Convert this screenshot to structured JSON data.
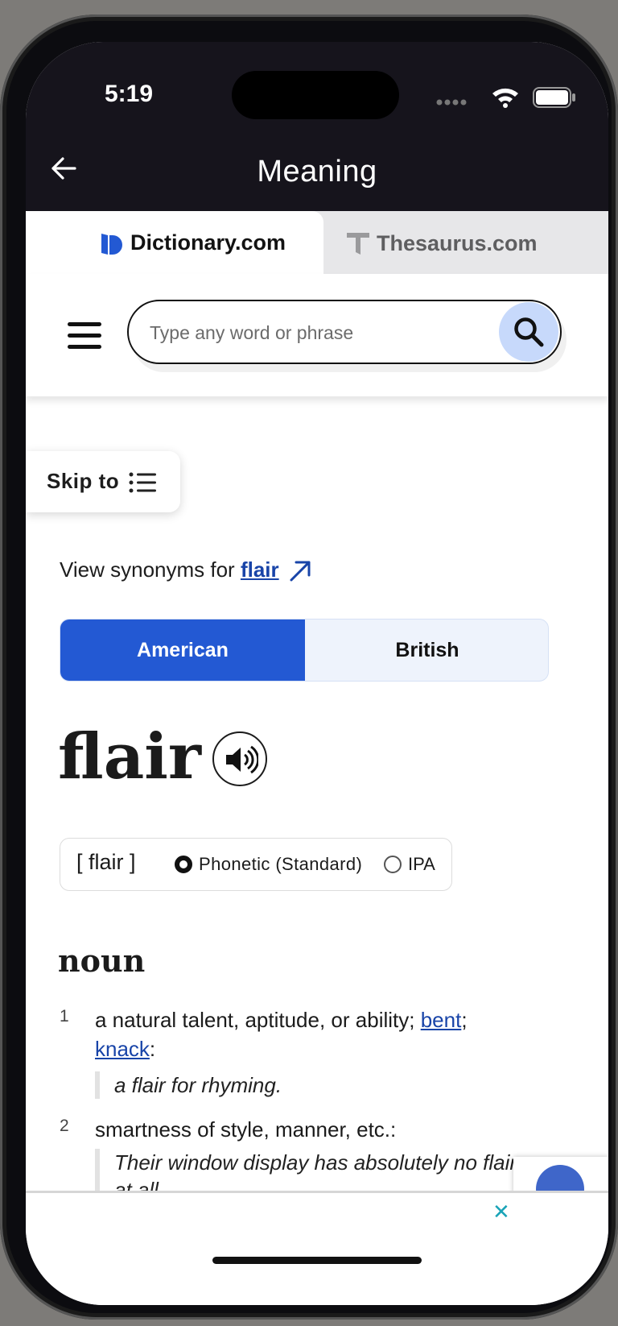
{
  "status_bar": {
    "time": "5:19"
  },
  "app_header": {
    "title": "Meaning",
    "back_icon": "arrow-left-icon"
  },
  "site_tabs": [
    {
      "label": "Dictionary.com",
      "active": true,
      "icon": "dictionary-logo-icon"
    },
    {
      "label": "Thesaurus.com",
      "active": false,
      "icon": "thesaurus-logo-icon"
    }
  ],
  "search": {
    "placeholder": "Type any word or phrase",
    "value": "",
    "icon": "search-icon",
    "button_color": "#c7d9fb"
  },
  "skip_to": {
    "label": "Skip to",
    "icon": "list-icon"
  },
  "synonyms": {
    "prefix": "View synonyms for ",
    "word": "flair"
  },
  "dialect_toggle": {
    "options": [
      "American",
      "British"
    ],
    "selected": "American",
    "accent": "#2359d3"
  },
  "entry": {
    "headword": "flair",
    "pronunciation": "[ flair ]",
    "pron_options": [
      "Phonetic (Standard)",
      "IPA"
    ],
    "pron_selected": "Phonetic (Standard)",
    "part_of_speech": "noun",
    "definitions": [
      {
        "num": "1",
        "text": "a natural talent, aptitude, or ability; ",
        "links": [
          "bent",
          "knack"
        ],
        "example": "a flair for rhyming."
      },
      {
        "num": "2",
        "text": "smartness of style, manner, etc.:",
        "example": "Their window display has absolutely no flair at all."
      }
    ]
  },
  "ad_banner": {
    "close": "✕"
  }
}
